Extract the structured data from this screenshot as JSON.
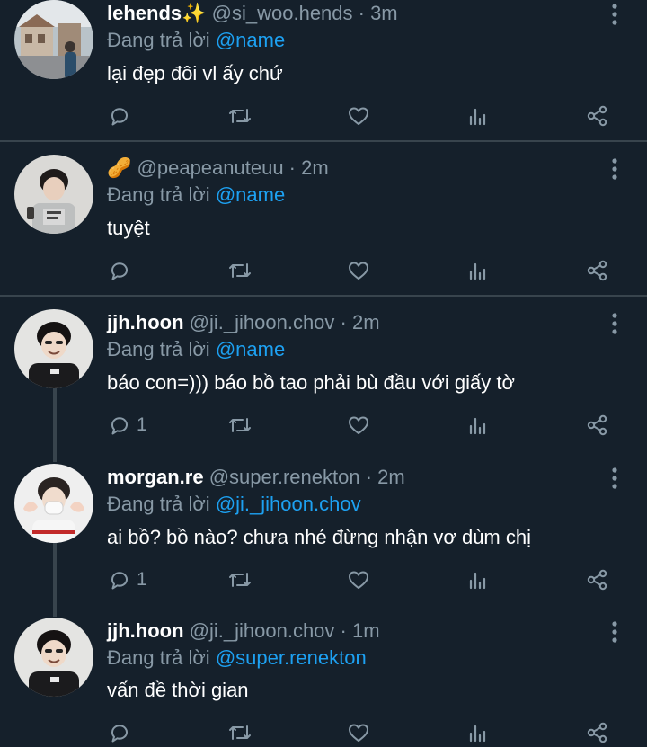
{
  "colors": {
    "background": "#15202b",
    "text_primary": "#ffffff",
    "text_secondary": "#8899a6",
    "mention": "#1da1f2",
    "divider": "#38444d"
  },
  "icons": {
    "reply": "reply-icon",
    "retweet": "retweet-icon",
    "like": "like-icon",
    "stats": "stats-icon",
    "share": "share-icon",
    "more": "more-icon"
  },
  "tweets": [
    {
      "name": "lehends✨",
      "handle": "@si_woo.hends · 3m",
      "reply_prefix": "Đang trả lời",
      "reply_to": "@name",
      "text": "lại đẹp đôi vl ấy chứ",
      "reply_count": ""
    },
    {
      "name": "🥜",
      "handle": "@peapeanuteuu · 2m",
      "reply_prefix": "Đang trả lời",
      "reply_to": "@name",
      "text": "tuyệt",
      "reply_count": ""
    },
    {
      "name": "jjh.hoon",
      "handle": "@ji._jihoon.chov · 2m",
      "reply_prefix": "Đang trả lời",
      "reply_to": "@name",
      "text": "báo con=))) báo bồ tao phải bù đầu với giấy tờ",
      "reply_count": "1"
    },
    {
      "name": "morgan.re",
      "handle": "@super.renekton · 2m",
      "reply_prefix": "Đang trả lời",
      "reply_to": "@ji._jihoon.chov",
      "text": "ai bồ? bồ nào? chưa nhé đừng nhận vơ dùm chị",
      "reply_count": "1"
    },
    {
      "name": "jjh.hoon",
      "handle": "@ji._jihoon.chov · 1m",
      "reply_prefix": "Đang trả lời",
      "reply_to": "@super.renekton",
      "text": "vấn đề thời gian",
      "reply_count": ""
    }
  ]
}
